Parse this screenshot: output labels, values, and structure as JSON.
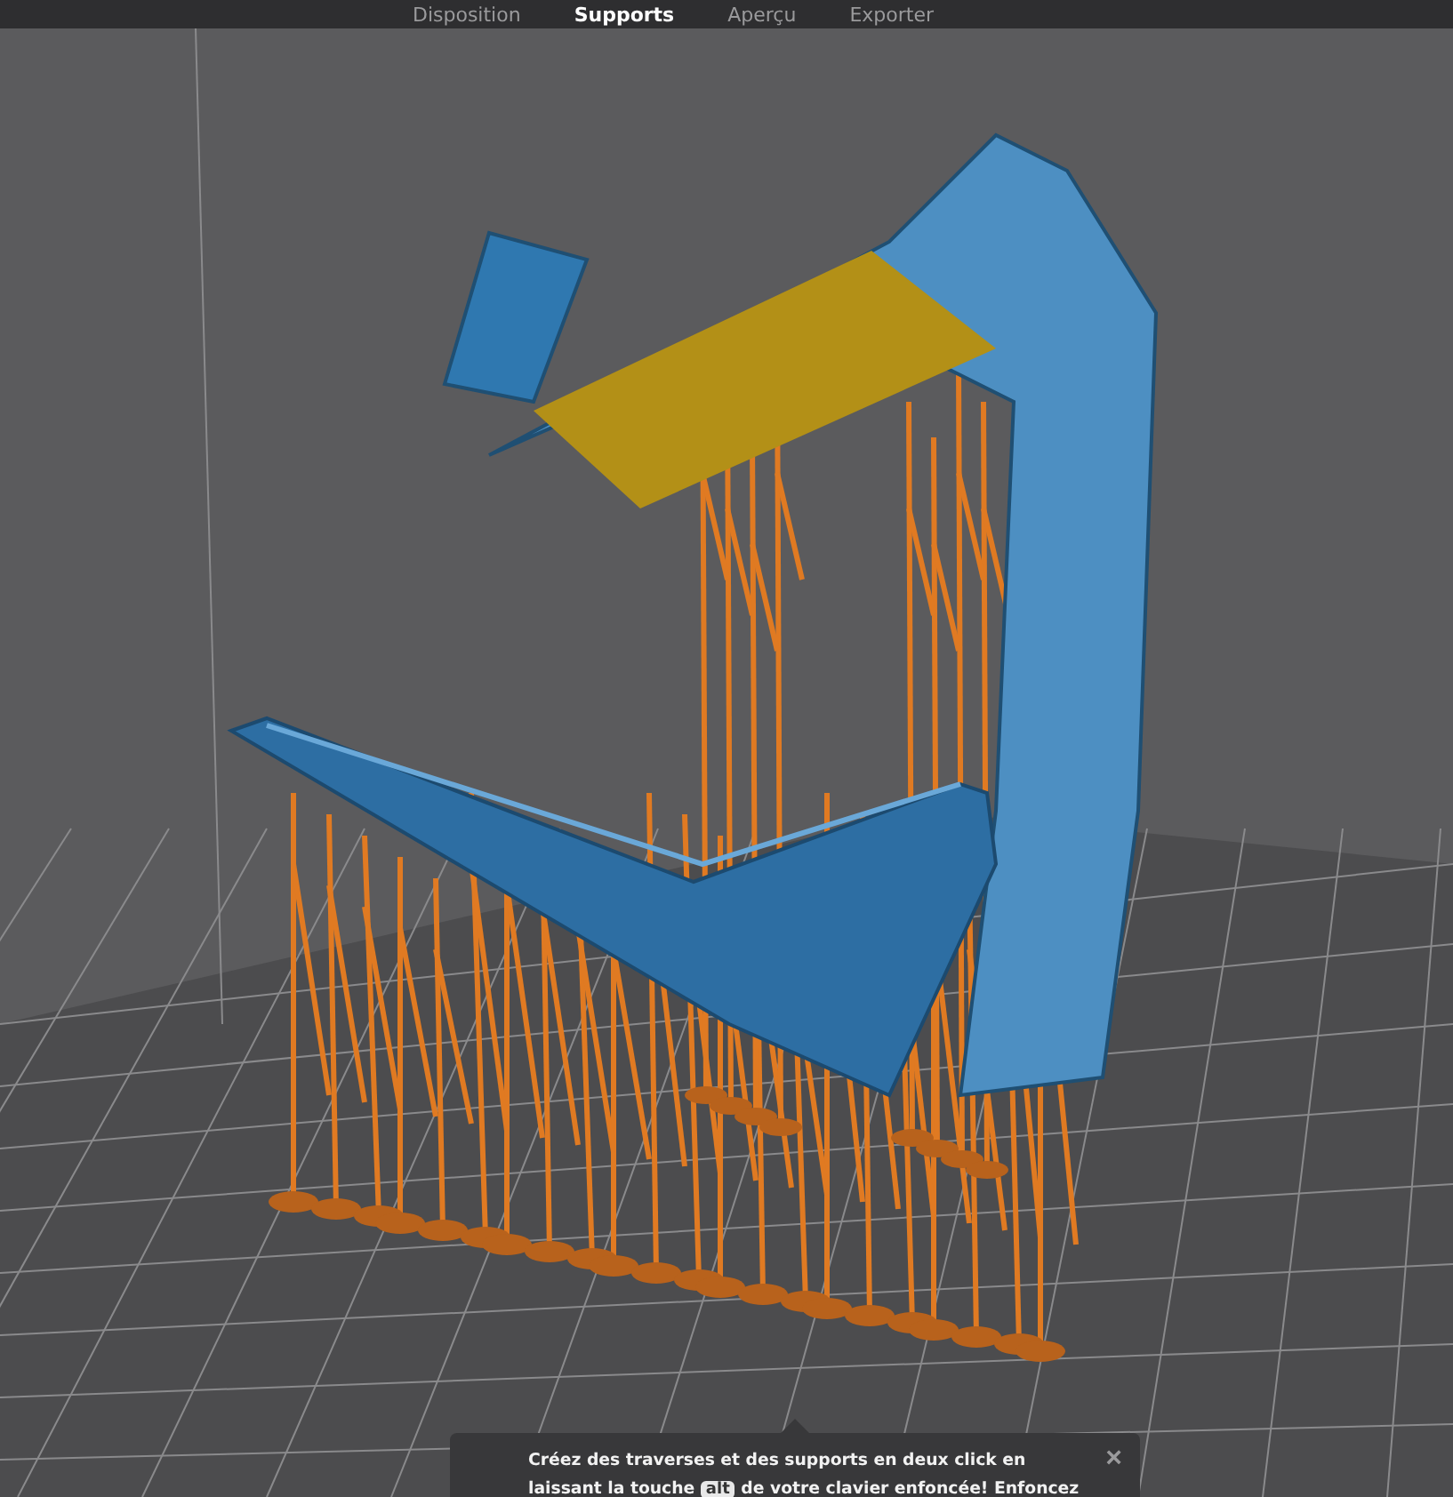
{
  "tabs": [
    {
      "label": "Disposition",
      "selected": false
    },
    {
      "label": "Supports",
      "selected": true
    },
    {
      "label": "Aperçu",
      "selected": false
    },
    {
      "label": "Exporter",
      "selected": false
    }
  ],
  "tooltip": {
    "text_before_key": "Créez des traverses et des supports en deux click en laissant la touche",
    "key": "alt",
    "text_after_key": "de votre clavier enfoncée! Enfoncez",
    "close": "×"
  }
}
